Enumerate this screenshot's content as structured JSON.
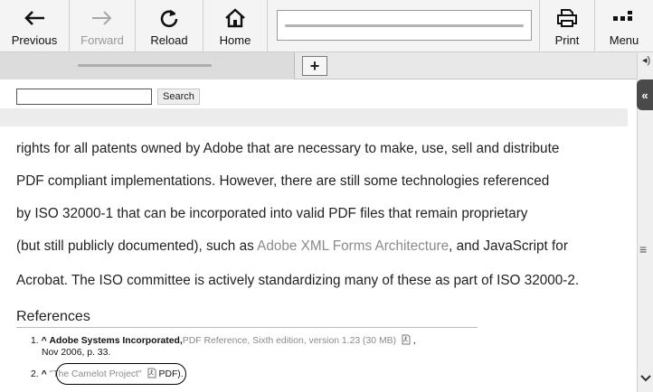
{
  "toolbar": {
    "previous_label": "Previous",
    "forward_label": "Forward",
    "reload_label": "Reload",
    "home_label": "Home",
    "print_label": "Print",
    "menu_label": "Menu",
    "address_value": ""
  },
  "tabs": {
    "new_tab_label": "+"
  },
  "search": {
    "button_label": "Search",
    "input_value": ""
  },
  "article": {
    "lines": {
      "l1": "rights for all patents owned by Adobe that are necessary to make, use, sell and distribute",
      "l2": "PDF compliant implementations. However, there are still some technologies referenced",
      "l3": "by ISO 32000-1 that can be incorporated into valid PDF files that remain proprietary",
      "l4_pre": "(but still publicly documented), such as ",
      "l4_link": "Adobe XML Forms Architecture",
      "l4_post": ", and JavaScript for",
      "l5": "Acrobat. The ISO committee is actively standardizing many of these as part of ISO 32000-2."
    }
  },
  "references": {
    "heading": "References",
    "r1": {
      "num": "1.",
      "caret": "^",
      "author": "Adobe Systems Incorporated,",
      "link": "PDF Reference, Sixth edition, version 1.23 (30 MB)",
      "tail": ",",
      "line2": "Nov 2006, p. 33."
    },
    "r2": {
      "num": "2.",
      "caret": "^",
      "link": "\"The Camelot Project\"",
      "tail": "PDF)."
    }
  },
  "colors": {
    "link": "#8a8a8a",
    "toolbar_bg": "#f4f4f4",
    "rail_tab": "#4a4a4a"
  },
  "icons": [
    "back-arrow-icon",
    "forward-arrow-icon",
    "reload-icon",
    "home-icon",
    "print-icon",
    "menu-icon",
    "plus-icon",
    "collapse-icon",
    "hamburger-icon",
    "chevron-down-icon",
    "pdf-icon"
  ]
}
